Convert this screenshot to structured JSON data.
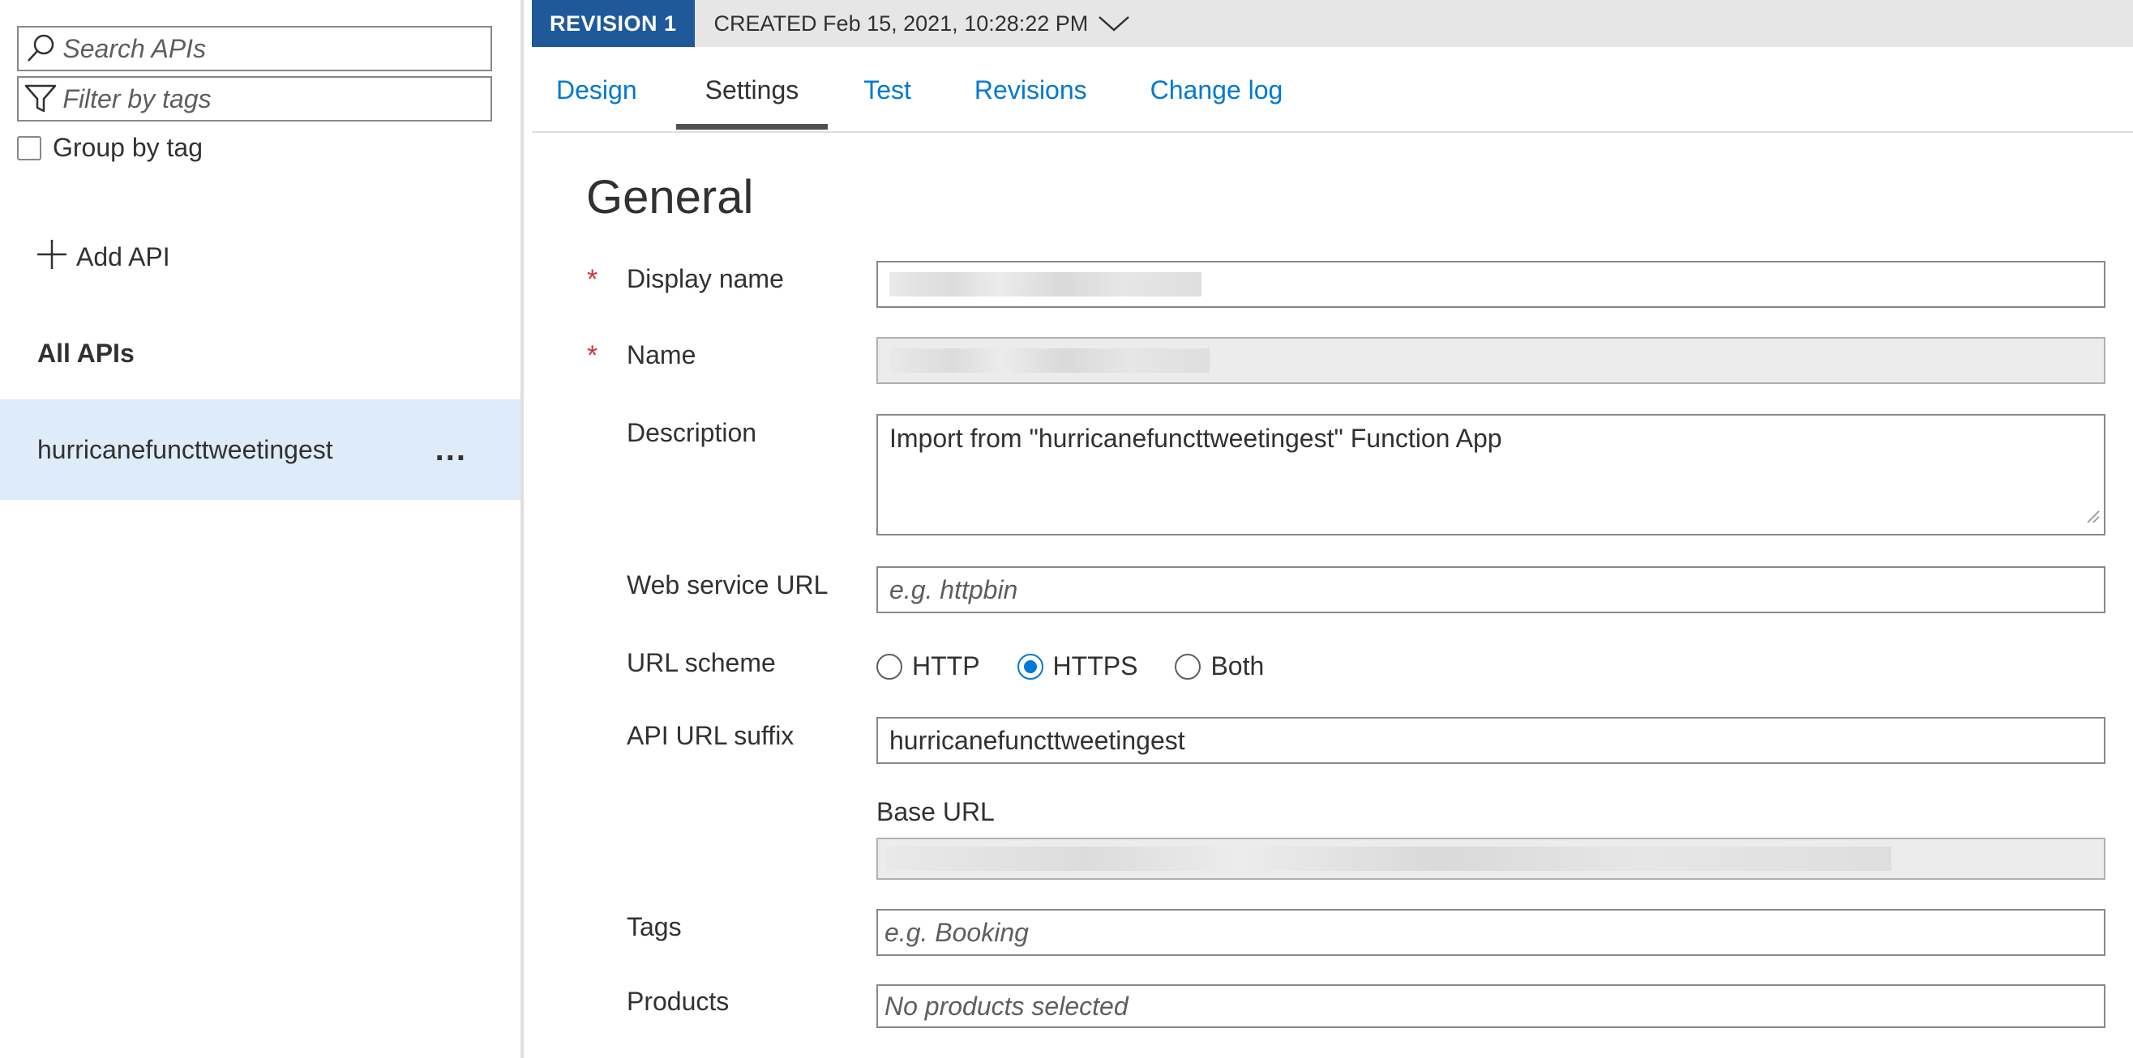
{
  "sidebar": {
    "search_placeholder": "Search APIs",
    "filter_placeholder": "Filter by tags",
    "group_by_label": "Group by tag",
    "add_api_label": "Add API",
    "all_apis_label": "All APIs",
    "api_items": [
      {
        "label": "hurricanefuncttweetingest",
        "more_label": "..."
      }
    ]
  },
  "revision": {
    "badge": "REVISION 1",
    "created": "CREATED Feb 15, 2021, 10:28:22 PM"
  },
  "tabs": [
    {
      "label": "Design",
      "active": false
    },
    {
      "label": "Settings",
      "active": true
    },
    {
      "label": "Test",
      "active": false
    },
    {
      "label": "Revisions",
      "active": false
    },
    {
      "label": "Change log",
      "active": false
    }
  ],
  "form": {
    "title": "General",
    "required_mark": "*",
    "display_name_label": "Display name",
    "name_label": "Name",
    "description_label": "Description",
    "description_value": "Import from \"hurricanefuncttweetingest\" Function App",
    "web_service_url_label": "Web service URL",
    "web_service_url_placeholder": "e.g. httpbin",
    "url_scheme_label": "URL scheme",
    "url_scheme_options": [
      {
        "label": "HTTP",
        "checked": false
      },
      {
        "label": "HTTPS",
        "checked": true
      },
      {
        "label": "Both",
        "checked": false
      }
    ],
    "api_url_suffix_label": "API URL suffix",
    "api_url_suffix_value": "hurricanefuncttweetingest",
    "base_url_label": "Base URL",
    "tags_label": "Tags",
    "tags_placeholder": "e.g. Booking",
    "products_label": "Products",
    "products_placeholder": "No products selected"
  },
  "colors": {
    "accent": "#0078d4",
    "revision_badge": "#1f5999",
    "selected_item_bg": "#deecf9",
    "required": "#d13438"
  }
}
